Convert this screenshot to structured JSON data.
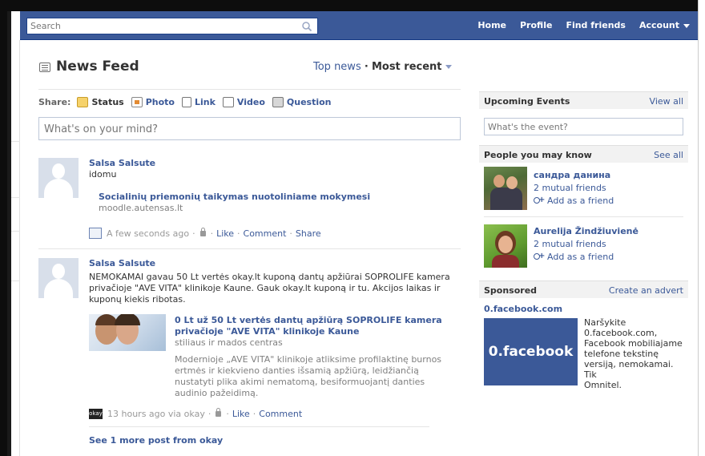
{
  "search": {
    "placeholder": "Search"
  },
  "nav": {
    "home": "Home",
    "profile": "Profile",
    "find_friends": "Find friends",
    "account": "Account"
  },
  "feed": {
    "title": "News Feed",
    "sort_top": "Top news",
    "sort_sep": "·",
    "sort_recent": "Most recent"
  },
  "share": {
    "label": "Share:",
    "status": "Status",
    "photo": "Photo",
    "link": "Link",
    "video": "Video",
    "question": "Question",
    "placeholder": "What's on your mind?"
  },
  "stories": [
    {
      "name": "Salsa Salsute",
      "text": "idomu",
      "attachment_title": "Socialinių priemonių taikymas nuotoliniame mokymesi",
      "attachment_sub": "moodle.autensas.lt",
      "time": "A few seconds ago",
      "actions": [
        "Like",
        "Comment",
        "Share"
      ]
    },
    {
      "name": "Salsa Salsute",
      "text_lines": [
        "NEMOKAMAI gavau 50 Lt vertės okay.lt kuponą dantų apžiūrai SOPROLIFE kamera",
        "privačioje \"AVE VITA\" klinikoje Kaune. Gauk okay.lt kuponą ir tu. Akcijos laikas ir",
        "kuponų kiekis ribotas."
      ],
      "attachment_title_lines": [
        "0 Lt už 50 Lt vertės dantų apžiūrą SOPROLIFE kamera",
        "privačioje \"AVE VITA\" klinikoje Kaune"
      ],
      "attachment_sub": "stiliaus ir mados centras",
      "attachment_desc_lines": [
        "Modernioje „AVE VITA\" klinikoje atliksime profilaktinę burnos",
        "ertmės ir kiekvieno danties išsamią apžiūrą, leidžiančią",
        "nustatyti plika akimi nematomą, besiformuojantį danties",
        "audinio pažeidimą."
      ],
      "time": "13 hours ago via okay",
      "icon_text": "okay",
      "actions": [
        "Like",
        "Comment"
      ]
    }
  ],
  "see_more": "See 1 more post from okay",
  "events": {
    "title": "Upcoming Events",
    "link": "View all",
    "placeholder": "What's the event?"
  },
  "pymk": {
    "title": "People you may know",
    "link": "See all",
    "people": [
      {
        "name": "сандра данина",
        "mutual": "2 mutual friends",
        "add": "Add as a friend"
      },
      {
        "name": "Aurelija Žindžiuvienė",
        "mutual": "2 mutual friends",
        "add": "Add as a friend"
      }
    ]
  },
  "sponsored": {
    "title": "Sponsored",
    "link": "Create an advert",
    "domain": "0.facebook.com",
    "ad_text": "0.facebook",
    "body_lines": [
      "Naršykite",
      "0.facebook.com,",
      "Facebook mobiliajame",
      "telefone tekstinę",
      "versiją, nemokamai. Tik",
      "Omnitel."
    ]
  },
  "colors": {
    "brand": "#3b5998",
    "link": "#3b5998",
    "muted": "#808080"
  }
}
